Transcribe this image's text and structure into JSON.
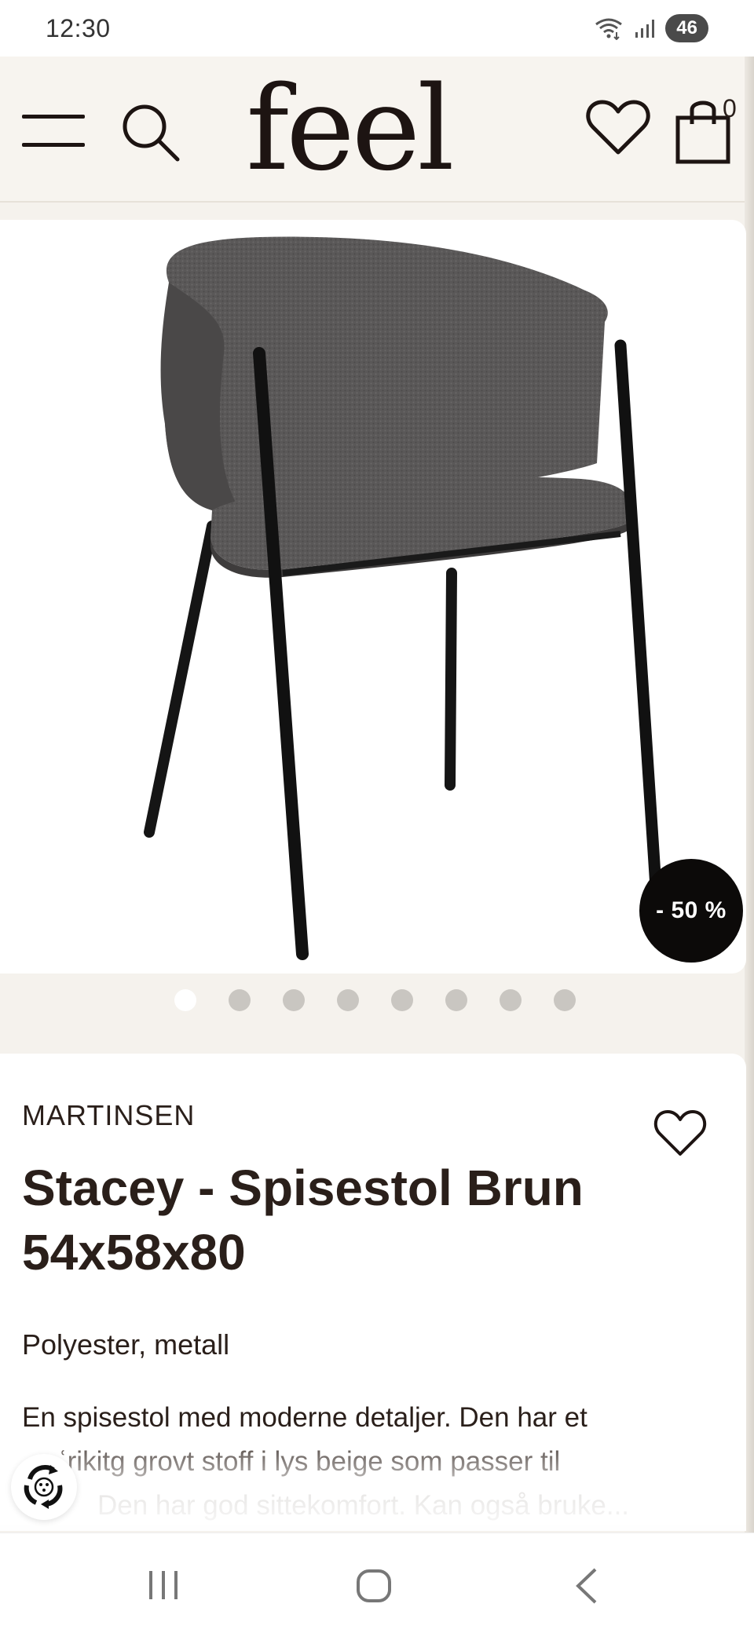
{
  "status_bar": {
    "time": "12:30",
    "battery": "46",
    "icons": [
      "wifi-icon",
      "signal-icon",
      "battery-icon"
    ]
  },
  "header": {
    "logo": "feel",
    "cart_count": "0",
    "icons": [
      "menu-icon",
      "search-icon",
      "heart-icon",
      "cart-icon"
    ]
  },
  "gallery": {
    "discount": "- 50 %",
    "dot_count": 8,
    "active_index": 0
  },
  "product": {
    "brand": "MARTINSEN",
    "title_line1": "Stacey - Spisestol Brun",
    "title_line2": "54x58x80",
    "materials": "Polyester, metall",
    "description_line1": "En spisestol med moderne detaljer. Den har et",
    "description_line2": "ʿrikitg grovt stoff i lys beige som passer til",
    "description_line3": "Den har god sittekomfort. Kan også bruke..."
  },
  "colors": {
    "header_bg": "#f7f4ef",
    "page_bg": "#f5f2ed",
    "text": "#2a1f1a",
    "badge": "#0c0a09"
  },
  "navigation": {
    "icons": [
      "recents-icon",
      "home-icon",
      "back-icon"
    ]
  }
}
